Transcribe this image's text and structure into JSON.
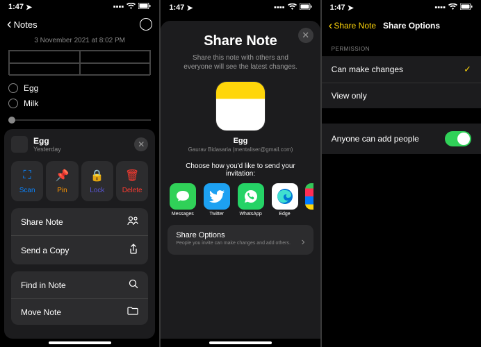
{
  "status": {
    "time": "1:47",
    "location_icon": "location",
    "signal": "signal",
    "wifi": "wifi",
    "battery": "battery"
  },
  "screen1": {
    "back_label": "Notes",
    "date": "3 November 2021 at 8:02 PM",
    "items": [
      "Egg",
      "Milk"
    ],
    "sheet": {
      "title": "Egg",
      "subtitle": "Yesterday",
      "actions": [
        {
          "label": "Scan",
          "class": "scan"
        },
        {
          "label": "Pin",
          "class": "pin"
        },
        {
          "label": "Lock",
          "class": "lock"
        },
        {
          "label": "Delete",
          "class": "delete"
        }
      ],
      "menu1": [
        {
          "label": "Share Note",
          "icon": "collaborate"
        },
        {
          "label": "Send a Copy",
          "icon": "share"
        }
      ],
      "menu2": [
        {
          "label": "Find in Note",
          "icon": "search"
        },
        {
          "label": "Move Note",
          "icon": "folder"
        }
      ]
    }
  },
  "screen2": {
    "title": "Share Note",
    "desc": "Share this note with others and everyone will see the latest changes.",
    "note_name": "Egg",
    "user": "Gaurav Bidasaria (mentaliser@gmail.com)",
    "invite": "Choose how you'd like to send your invitation:",
    "apps": [
      "Messages",
      "Twitter",
      "WhatsApp",
      "Edge"
    ],
    "options_title": "Share Options",
    "options_desc": "People you invite can make changes and add others."
  },
  "screen3": {
    "back": "Share Note",
    "title": "Share Options",
    "permission_label": "PERMISSION",
    "perm1": "Can make changes",
    "perm2": "View only",
    "anyone": "Anyone can add people"
  }
}
